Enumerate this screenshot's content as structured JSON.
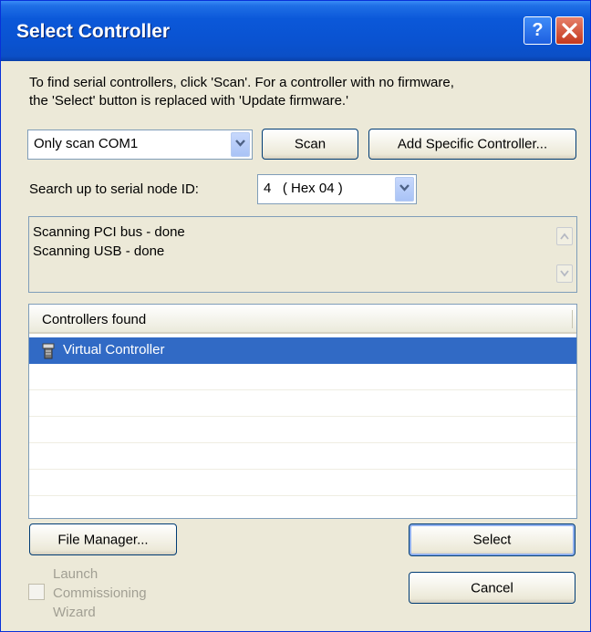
{
  "window": {
    "title": "Select Controller",
    "help_glyph": "?",
    "close_glyph": "X"
  },
  "instructions": {
    "line1": "To find serial controllers, click 'Scan'.  For a controller with no firmware,",
    "line2": "the 'Select' button is replaced with 'Update firmware.'"
  },
  "scan_combo": {
    "value": "Only scan COM1"
  },
  "buttons": {
    "scan": "Scan",
    "add_specific": "Add Specific Controller...",
    "file_manager": "File Manager...",
    "select": "Select",
    "cancel": "Cancel"
  },
  "node_id": {
    "label": "Search up to serial node ID:",
    "value": "4   ( Hex 04 )"
  },
  "status": {
    "lines": [
      "Scanning PCI bus - done",
      "Scanning USB - done"
    ]
  },
  "controllers": {
    "header": "Controllers found",
    "items": [
      {
        "label": "Virtual Controller",
        "icon": "controller-icon",
        "selected": true
      }
    ]
  },
  "launch_wizard": {
    "line1": "Launch",
    "line2": "Commissioning",
    "line3": "Wizard",
    "checked": false,
    "enabled": false
  },
  "colors": {
    "title_bar": "#0b58d9",
    "selection": "#316ac5",
    "dialog_bg": "#ece9d8"
  }
}
